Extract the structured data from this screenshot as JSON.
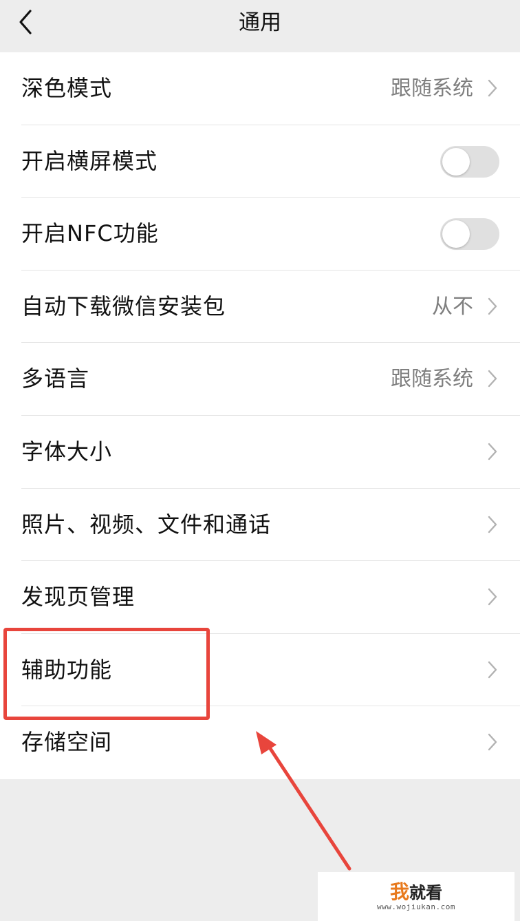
{
  "header": {
    "title": "通用",
    "back_icon": "chevron-left-icon"
  },
  "settings": [
    {
      "label": "深色模式",
      "value": "跟随系统",
      "kind": "link"
    },
    {
      "label": "开启横屏模式",
      "kind": "toggle",
      "on": false
    },
    {
      "label": "开启NFC功能",
      "kind": "toggle",
      "on": false
    },
    {
      "label": "自动下载微信安装包",
      "value": "从不",
      "kind": "link"
    },
    {
      "label": "多语言",
      "value": "跟随系统",
      "kind": "link"
    },
    {
      "label": "字体大小",
      "value": "",
      "kind": "link"
    },
    {
      "label": "照片、视频、文件和通话",
      "value": "",
      "kind": "link"
    },
    {
      "label": "发现页管理",
      "value": "",
      "kind": "link"
    },
    {
      "label": "辅助功能",
      "value": "",
      "kind": "link",
      "highlighted": true
    },
    {
      "label": "存储空间",
      "value": "",
      "kind": "link"
    }
  ],
  "annotation": {
    "highlight_color": "#e8453c",
    "arrow_color": "#e8453c"
  },
  "watermark": {
    "accent": "我",
    "text": "就看",
    "url": "www.wojiukan.com"
  },
  "colors": {
    "background": "#ededed",
    "card": "#ffffff",
    "secondary_text": "#7f7f7f",
    "toggle_off": "#e0e0e0"
  }
}
